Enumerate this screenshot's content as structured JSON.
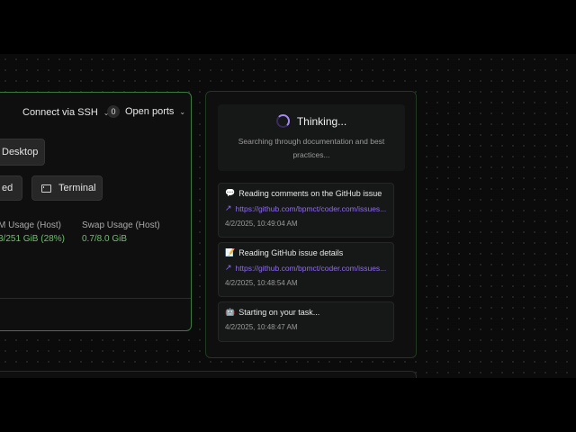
{
  "workspace": {
    "connect_ssh": "Connect via SSH",
    "open_ports_count": "0",
    "open_ports_label": "Open ports",
    "buttons": {
      "desktop": "Desktop",
      "partial": "ed",
      "terminal": "Terminal"
    },
    "stats": {
      "ram_label": "M Usage (Host)",
      "ram_value": "3/251 GiB (28%)",
      "swap_label": "Swap Usage (Host)",
      "swap_value": "0.7/8.0 GiB"
    }
  },
  "activity": {
    "thinking_title": "Thinking...",
    "thinking_sub": "Searching through documentation and best practices...",
    "items": [
      {
        "emoji": "💬",
        "title": "Reading comments on the GitHub issue",
        "link": "https://github.com/bpmct/coder.com/issues...",
        "time": "4/2/2025, 10:49:04 AM"
      },
      {
        "emoji": "📝",
        "title": "Reading GitHub issue details",
        "link": "https://github.com/bpmct/coder.com/issues...",
        "time": "4/2/2025, 10:48:54 AM"
      },
      {
        "emoji": "🤖",
        "title": "Starting on your task...",
        "time": "4/2/2025, 10:48:47 AM"
      }
    ]
  },
  "colors": {
    "accent_green": "#3d7a3f",
    "stat_value": "#6fbf6d",
    "link_purple": "#8f6df0",
    "spinner": "#a58af0"
  }
}
